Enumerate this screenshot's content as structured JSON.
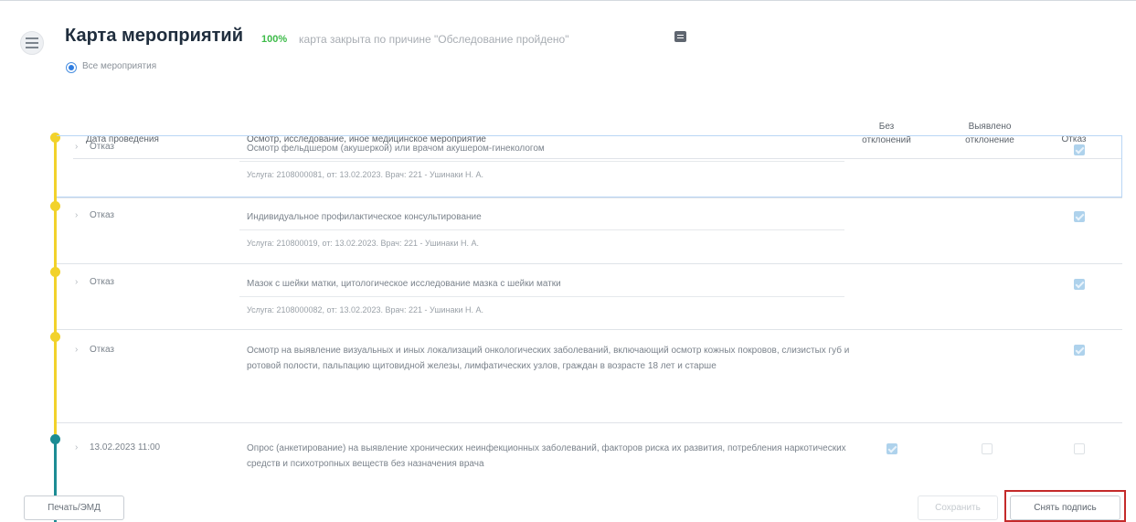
{
  "header": {
    "title": "Карта мероприятий",
    "percent": "100%",
    "closed_note": "карта закрыта по причине \"Обследование пройдено\"",
    "menu_icon": "hamburger-icon",
    "doc_icon": "document-icon",
    "filter_label": "Все мероприятия"
  },
  "table": {
    "columns": {
      "date": "Дата проведения",
      "description": "Осмотр, исследование, иное медицинское мероприятие",
      "no_deviation": "Без отклонений",
      "deviation_found": "Выявлено отклонение",
      "refusal": "Отказ"
    },
    "rows": [
      {
        "date": "Отказ",
        "description": "Осмотр фельдшером (акушеркой) или врачом акушером-гинекологом",
        "service": "Услуга: 2108000081, от: 13.02.2023. Врач: 221 - Ушинаки Н. А.",
        "refusal_checked": true
      },
      {
        "date": "Отказ",
        "description": "Индивидуальное профилактическое консультирование",
        "service": "Услуга: 210800019, от: 13.02.2023. Врач: 221 - Ушинаки Н. А.",
        "refusal_checked": true
      },
      {
        "date": "Отказ",
        "description": "Мазок с шейки матки, цитологическое исследование мазка с шейки матки",
        "service": "Услуга: 2108000082, от: 13.02.2023. Врач: 221 - Ушинаки Н. А.",
        "refusal_checked": true
      },
      {
        "date": "Отказ",
        "description": "Осмотр на выявление визуальных и иных локализаций онкологических заболеваний, включающий осмотр кожных покровов, слизистых губ и ротовой полости, пальпацию щитовидной железы, лимфатических узлов, граждан в возрасте 18 лет и старше",
        "refusal_checked": true
      },
      {
        "date": "13.02.2023 11:00",
        "description": "Опрос (анкетирование) на выявление хронических неинфекционных заболеваний, факторов риска их развития, потребления наркотических средств и психотропных веществ без назначения врача",
        "no_deviation_checked": true
      }
    ]
  },
  "footer": {
    "print_label": "Печать/ЭМД",
    "save_label": "Сохранить",
    "unsign_label": "Снять подпись"
  },
  "colors": {
    "percent": "#3dbb49",
    "timeline_pending": "#f2d22b",
    "timeline_done": "#1c8c94",
    "highlight_frame": "#c42a2a"
  }
}
